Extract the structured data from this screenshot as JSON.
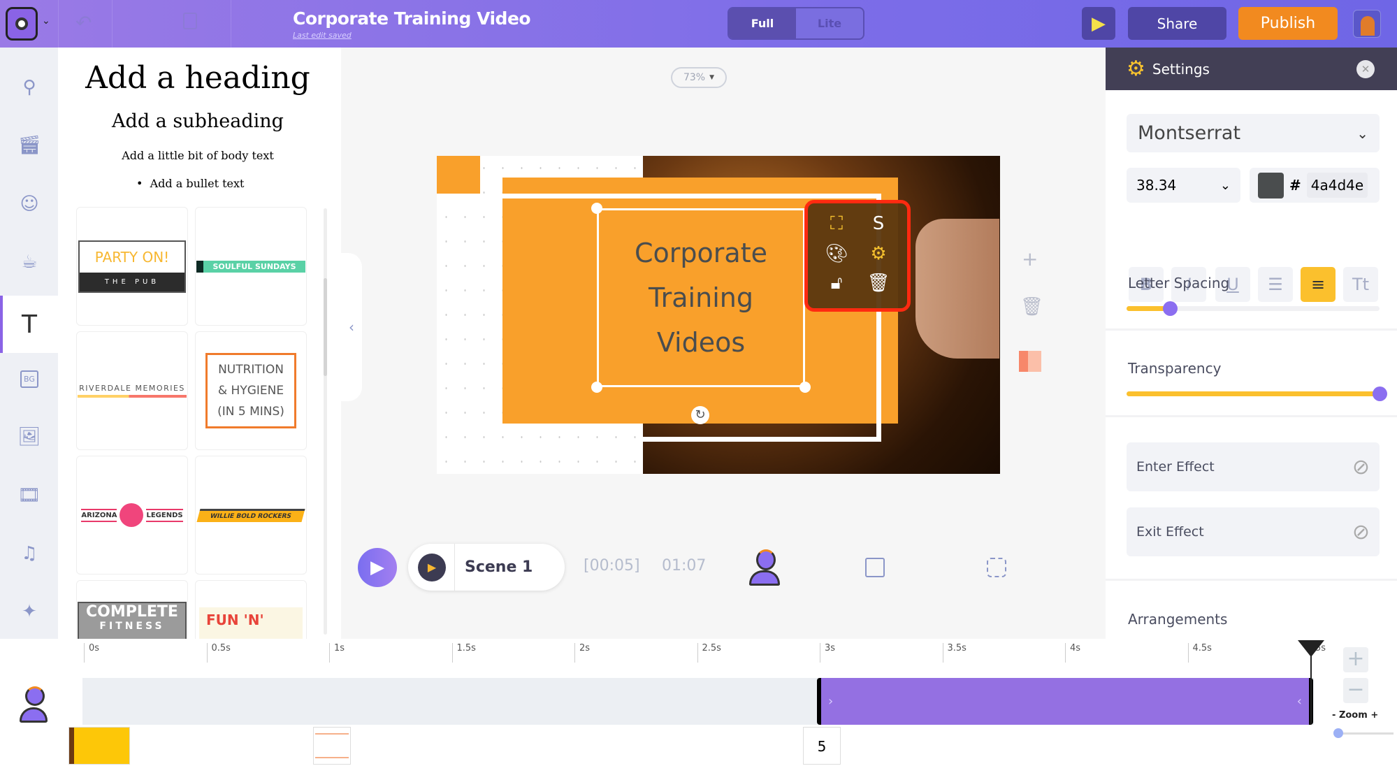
{
  "header": {
    "title": "Corporate Training Video",
    "subtitle": "Last edit saved",
    "modes": [
      "Full",
      "Lite"
    ],
    "active_mode": "Full",
    "share": "Share",
    "publish": "Publish",
    "colors": {
      "bar": "#7c6de8",
      "publish": "#f28a1f",
      "share": "#4f46a6"
    }
  },
  "rail": {
    "items": [
      "search-icon",
      "scene-icon",
      "character-icon",
      "props-icon",
      "text-icon",
      "background-icon",
      "image-icon",
      "video-icon",
      "music-icon",
      "effects-icon"
    ],
    "active": "text-icon",
    "bg_label": "BG"
  },
  "text_panel": {
    "heading": "Add a heading",
    "subheading": "Add a subheading",
    "body": "Add a little bit of body text",
    "bullet": "Add a bullet text",
    "templates": [
      {
        "line1": "PARTY ON!",
        "line2": "THE PUB"
      },
      {
        "line1": "SOULFUL SUNDAYS"
      },
      {
        "line1": "RIVERDALE MEMORIES"
      },
      {
        "line1": "NUTRITION",
        "line2": "& HYGIENE",
        "line3": "(IN 5 MINS)"
      },
      {
        "line1": "ARIZONA",
        "line2": "LEGENDS"
      },
      {
        "line1": "WILLIE BOLD ROCKERS"
      },
      {
        "line1": "COMPLETE",
        "line2": "FITNESS"
      },
      {
        "line1": "FUN 'N'"
      }
    ]
  },
  "canvas": {
    "zoom": "73%",
    "text_lines": [
      "Corporate",
      "Training",
      "Videos"
    ],
    "text_color": "#4a4d4e",
    "box_color": "#f9a02b"
  },
  "playback": {
    "scene": "Scene 1",
    "scene_duration": "[00:05]",
    "total": "01:07"
  },
  "settings": {
    "title": "Settings",
    "font": "Montserrat",
    "size": "38.34",
    "color_hash": "#",
    "color": "4a4d4e",
    "format_buttons": [
      "B",
      "I",
      "U",
      "list",
      "center",
      "Tt"
    ],
    "active_format": "center",
    "letter_spacing_label": "Letter Spacing",
    "letter_spacing": 0.17,
    "transparency_label": "Transparency",
    "transparency": 1.0,
    "enter_effect": "Enter Effect",
    "exit_effect": "Exit Effect",
    "arrangements": "Arrangements"
  },
  "timeline": {
    "ticks": [
      "0s",
      "0.5s",
      "1s",
      "1.5s",
      "2s",
      "2.5s",
      "3s",
      "3.5s",
      "4s",
      "4.5s",
      "5s"
    ],
    "clip_start": 3,
    "clip_end": 5,
    "zoom_label": "Zoom",
    "zoom_minus": "-",
    "zoom_plus": "+",
    "scene_number": "5"
  }
}
